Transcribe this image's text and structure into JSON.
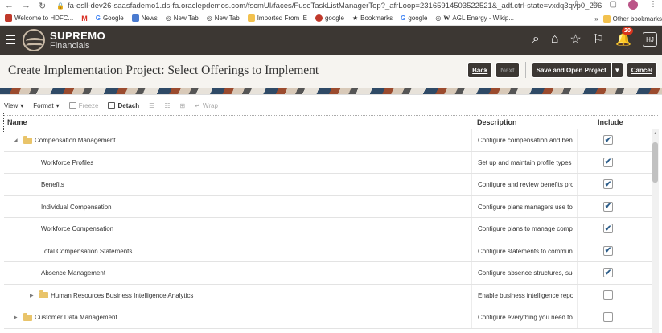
{
  "browser": {
    "url": "fa-esll-dev26-saasfademo1.ds-fa.oraclepdemos.com/fscmUI/faces/FuseTaskListManagerTop?_afrLoop=23165914503522521&_adf.ctrl-state=vxdq3qvp0_296",
    "bookmarks": [
      "Welcome to HDFC...",
      "Google",
      "News",
      "New Tab",
      "New Tab",
      "Imported From IE",
      "google",
      "Bookmarks",
      "google",
      "AGL Energy - Wikip..."
    ],
    "other_bookmarks": "Other bookmarks",
    "more": "»"
  },
  "header": {
    "brand_name": "SUPREMO",
    "brand_sub": "Financials",
    "notification_count": "20",
    "user_initials": "HJ"
  },
  "page": {
    "title": "Create Implementation Project: Select Offerings to Implement",
    "buttons": {
      "back": "Back",
      "next": "Next",
      "save_open": "Save and Open Project",
      "cancel": "Cancel"
    }
  },
  "toolbar": {
    "view": "View",
    "format": "Format",
    "freeze": "Freeze",
    "detach": "Detach",
    "wrap": "Wrap"
  },
  "table": {
    "columns": {
      "name": "Name",
      "description": "Description",
      "include": "Include"
    },
    "rows": [
      {
        "name": "Compensation Management",
        "description": "Configure compensation and benef",
        "checked": true,
        "level": 0,
        "folder": true,
        "expander": "open"
      },
      {
        "name": "Workforce Profiles",
        "description": "Set up and maintain profile types ir",
        "checked": true,
        "level": 1,
        "folder": false,
        "expander": ""
      },
      {
        "name": "Benefits",
        "description": "Configure and review benefits prog",
        "checked": true,
        "level": 1,
        "folder": false,
        "expander": ""
      },
      {
        "name": "Individual Compensation",
        "description": "Configure plans managers use to a",
        "checked": true,
        "level": 1,
        "folder": false,
        "expander": ""
      },
      {
        "name": "Workforce Compensation",
        "description": "Configure plans to manage compe",
        "checked": true,
        "level": 1,
        "folder": false,
        "expander": ""
      },
      {
        "name": "Total Compensation Statements",
        "description": "Configure statements to communic",
        "checked": true,
        "level": 1,
        "folder": false,
        "expander": ""
      },
      {
        "name": "Absence Management",
        "description": "Configure absence structures, sucl",
        "checked": true,
        "level": 1,
        "folder": false,
        "expander": ""
      },
      {
        "name": "Human Resources Business Intelligence Analytics",
        "description": "Enable business intelligence report",
        "checked": false,
        "level": 1,
        "folder": true,
        "expander": "closed"
      },
      {
        "name": "Customer Data Management",
        "description": "Configure everything you need to n",
        "checked": false,
        "level": 0,
        "folder": true,
        "expander": "closed"
      }
    ]
  }
}
